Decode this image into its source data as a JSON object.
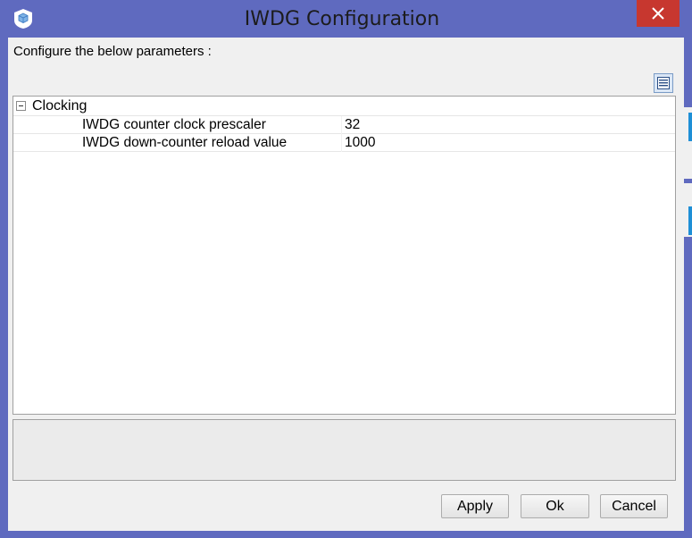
{
  "window": {
    "title": "IWDG Configuration",
    "close_icon": "close-icon",
    "app_icon": "cube-app-icon"
  },
  "dialog": {
    "heading": "Configure the below parameters :",
    "toggle_view_icon": "list-view-icon"
  },
  "tree": {
    "group": {
      "label": "Clocking",
      "expanded": true
    },
    "params": [
      {
        "name": "IWDG counter clock prescaler",
        "value": "32"
      },
      {
        "name": "IWDG down-counter reload value",
        "value": "1000"
      }
    ]
  },
  "description": "",
  "buttons": {
    "apply": "Apply",
    "ok": "Ok",
    "cancel": "Cancel"
  },
  "colors": {
    "titlebar": "#5f6abf",
    "close": "#c7372f",
    "dialog_bg": "#f0f0f0",
    "accent_edge": "#1e8fd6"
  }
}
